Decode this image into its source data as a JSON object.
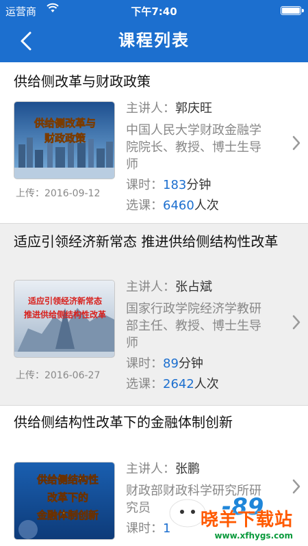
{
  "status_bar": {
    "carrier": "运营商",
    "time": "下午7:40"
  },
  "nav": {
    "title": "课程列表"
  },
  "courses": [
    {
      "title": "供给侧改革与财政政策",
      "thumb_text": [
        "供给侧改革与",
        "财政政策"
      ],
      "upload_label": "上传：",
      "upload_date": "2016-09-12",
      "lecturer_label": "主讲人：",
      "lecturer": "郭庆旺",
      "affiliation": [
        "中国人民大学财政金融学",
        "院院长、教授、博士生导",
        "师"
      ],
      "hours_label": "课时：",
      "hours_value": "183",
      "hours_unit": "分钟",
      "enroll_label": "选课：",
      "enroll_value": "6460",
      "enroll_unit": "人次"
    },
    {
      "title": "适应引领经济新常态 推进供给侧结构性改革",
      "thumb_text": [
        "适应引领经济新常态",
        "推进供给侧结构性改革"
      ],
      "upload_label": "上传：",
      "upload_date": "2016-06-27",
      "lecturer_label": "主讲人：",
      "lecturer": "张占斌",
      "affiliation": [
        "国家行政学院经济学教研",
        "部主任、教授、博士生导",
        "师"
      ],
      "hours_label": "课时：",
      "hours_value": "89",
      "hours_unit": "分钟",
      "enroll_label": "选课：",
      "enroll_value": "2642",
      "enroll_unit": "人次"
    },
    {
      "title": "供给侧结构性改革下的金融体制创新",
      "thumb_text": [
        "供给侧结构性",
        "改革下的",
        "金融体制创新"
      ],
      "lecturer_label": "主讲人：",
      "lecturer": "张鹏",
      "affiliation": [
        "财政部财政科学研究所研",
        "究员"
      ],
      "hours_label": "课时：",
      "hours_value": "1"
    }
  ],
  "watermark": {
    "brand": "晓羊下载站",
    "url": "www.xfhygs.com"
  },
  "colors": {
    "header": "#1c6fcf",
    "accent_number": "#1c6fcf",
    "alt_row": "#efefef"
  }
}
